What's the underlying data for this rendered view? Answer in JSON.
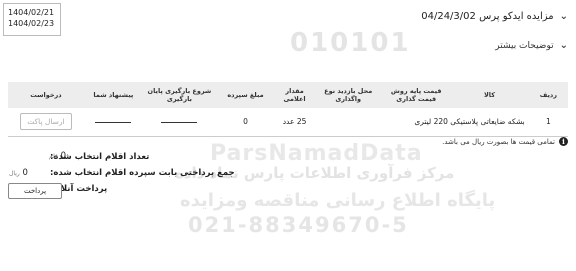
{
  "dates": {
    "start": "1404/02/21",
    "end": "1404/02/23"
  },
  "header": {
    "title": "مزایده ایدکو پرس 04/24/3/02",
    "details_label": "توضیحات بیشتر"
  },
  "table": {
    "headers": {
      "row": "ردیف",
      "description": "کالا",
      "base_price": "قیمت پایه روش قیمت گذاری",
      "place": "محل بازدید نوع واگذاری",
      "quantity": "مقدار اعلامی",
      "deposit": "مبلغ سپرده",
      "start_end": "شروع بارگیری پایان بارگیری",
      "offer": "پیشنهاد شما",
      "request": "درخواست"
    },
    "rows": [
      {
        "row": "1",
        "description": "بشکه ضایعاتی پلاستیکی 220 لیتری",
        "quantity": "25 عدد",
        "deposit": "0",
        "send_label": "ارسال پاکت"
      }
    ]
  },
  "note": "تمامی قیمت ها بصورت ریال می باشد.",
  "summary": {
    "selected_count_label": "تعداد اقلام انتخاب شده:",
    "selected_count_value": "0",
    "count_unit": "قلم",
    "deposit_total_label": "جمع پرداختی بابت سپرده اقلام انتخاب شده:",
    "deposit_total_value": "0",
    "deposit_unit": "ریال",
    "online_payment_label": "پرداخت آنلاین",
    "pay_button": "پرداخت"
  },
  "watermark": {
    "digits": "010101",
    "site": "ParsNamadData",
    "line1": "مرکز فرآوری اطلاعات پارس نماد داده",
    "line2": "پایگاه اطلاع رسانی مناقصه ومزایده",
    "phone": "021-88349670-5"
  }
}
